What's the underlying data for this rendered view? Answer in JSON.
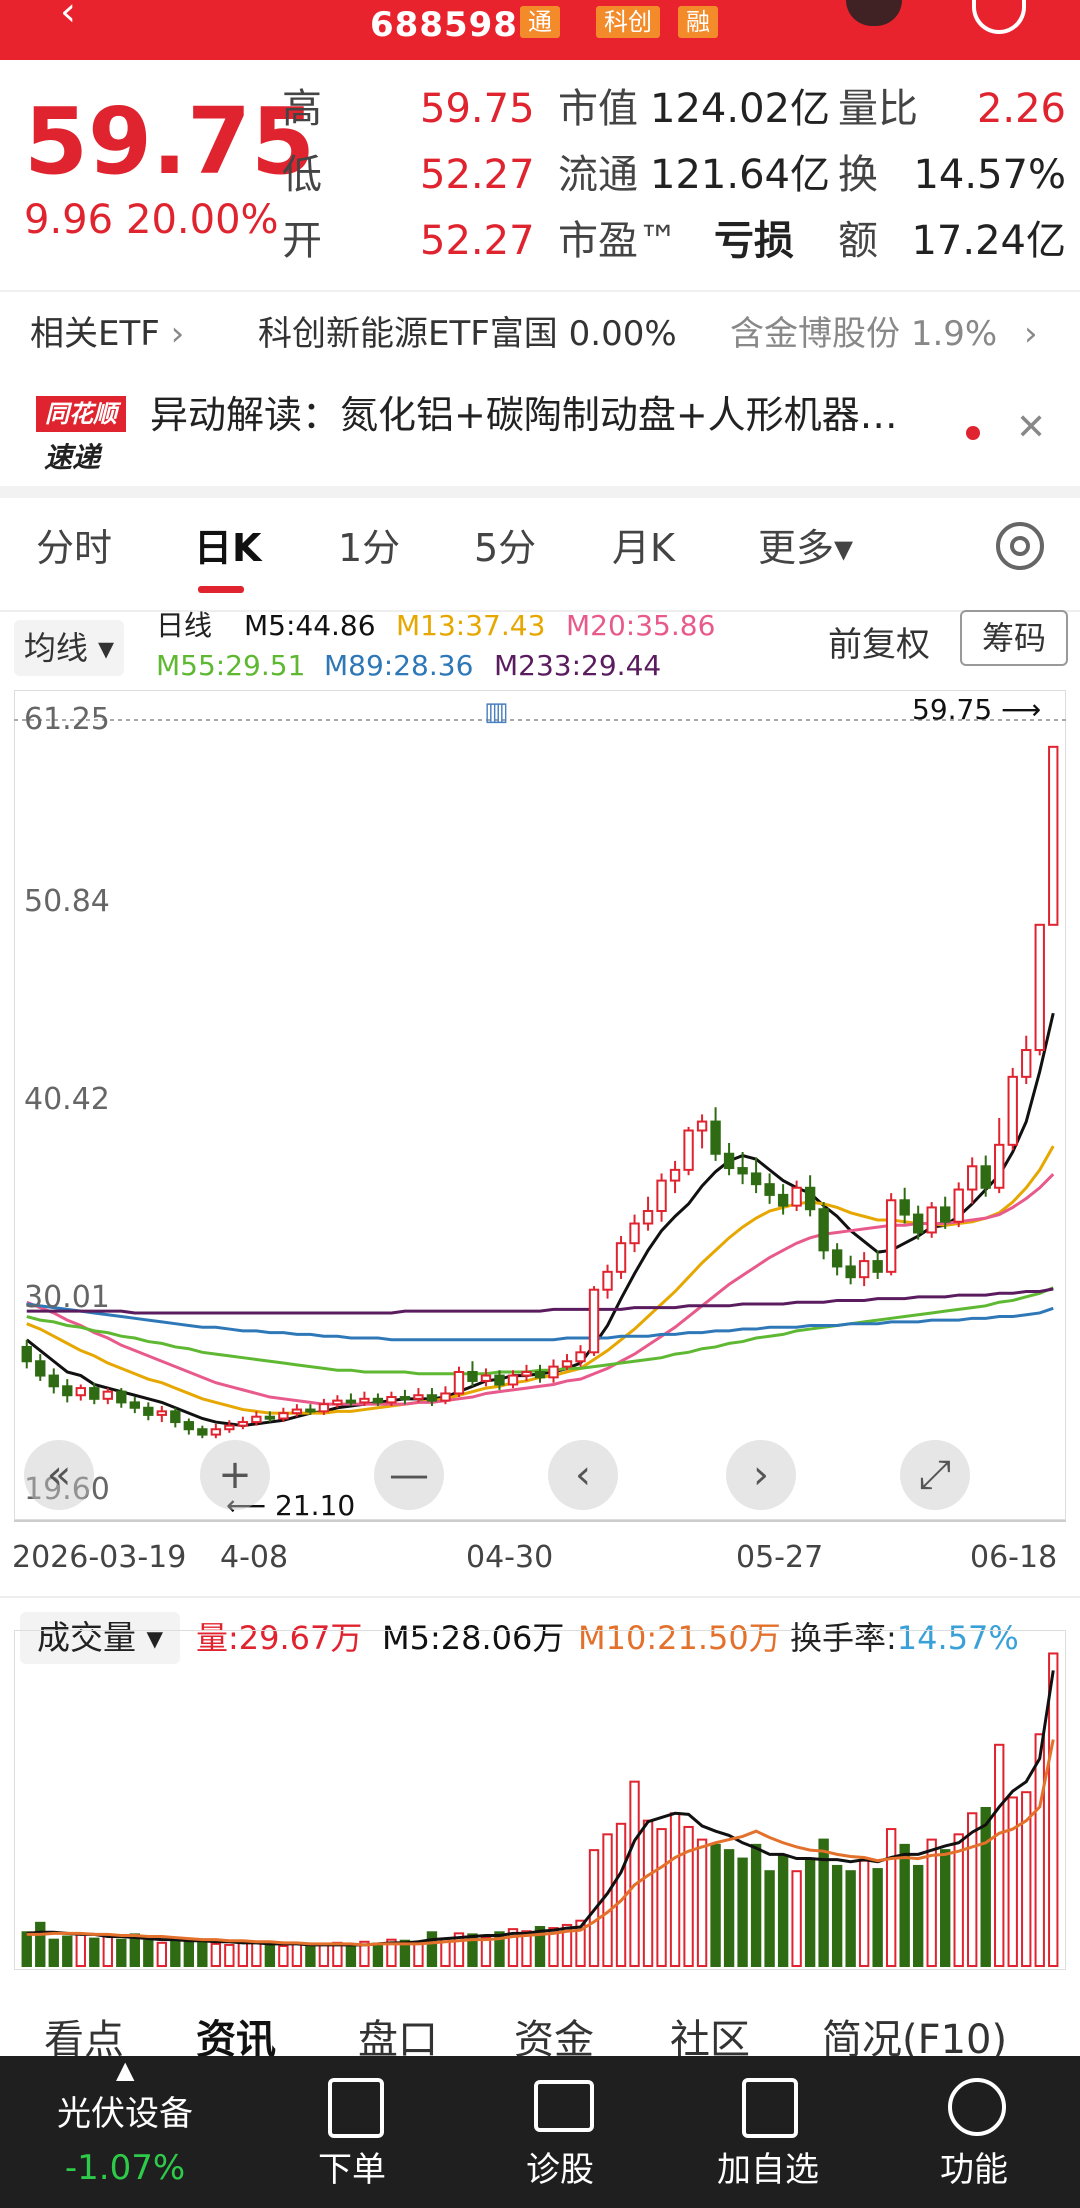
{
  "header": {
    "code": "688598",
    "tags": [
      "通",
      "科创",
      "融"
    ],
    "colors": {
      "bar": "#e8232e",
      "tag": "#f48b2a"
    }
  },
  "quote": {
    "price": "59.75",
    "change": "9.96",
    "change_pct": "20.00%",
    "rows": [
      {
        "l1": "高",
        "v1": "59.75",
        "l2": "市值",
        "v2": "124.02亿",
        "l3": "量比",
        "v3": "2.26"
      },
      {
        "l1": "低",
        "v1": "52.27",
        "l2": "流通",
        "v2": "121.64亿",
        "l3": "换",
        "v3": "14.57%"
      },
      {
        "l1": "开",
        "v1": "52.27",
        "l2": "市盈™",
        "v2": "亏损",
        "l3": "额",
        "v3": "17.24亿"
      }
    ]
  },
  "etf": {
    "label": "相关ETF",
    "item1_name": "科创新能源ETF富国",
    "item1_value": "0.00%",
    "item2_name": "含金博股份",
    "item2_value": "1.9%"
  },
  "news": {
    "logo_top": "同花顺",
    "logo_bottom": "速递",
    "text": "异动解读：氮化铝+碳陶制动盘+人形机器…"
  },
  "tabs": [
    "分时",
    "日K",
    "1分",
    "5分",
    "月K",
    "更多▾"
  ],
  "ma_legend": {
    "button": "均线 ▾",
    "period": "日线",
    "m5": "M5:44.86",
    "m13": "M13:37.43",
    "m20": "M20:35.86",
    "m55": "M55:29.51",
    "m89": "M89:28.36",
    "m233": "M233:29.44",
    "fuquan": "前复权",
    "chip": "筹码",
    "colors": {
      "m5": "#111111",
      "m13": "#e6a700",
      "m20": "#e85a8c",
      "m55": "#5fb832",
      "m89": "#2f78b8",
      "m233": "#5a1c5e"
    }
  },
  "chart": {
    "y_ticks": [
      "61.25",
      "50.84",
      "40.42",
      "30.01",
      "19.60"
    ],
    "x_ticks": [
      "2026-03-19",
      "4-08",
      "04-30",
      "05-27",
      "06-18"
    ],
    "high_label": "59.75",
    "low_label": "21.10",
    "nav": {
      "first": "«",
      "zoom_in": "+",
      "zoom_out": "—",
      "prev": "‹",
      "next": "›",
      "fullscreen": "⤢"
    }
  },
  "chart_data": {
    "type": "candlestick",
    "ylim": [
      19.6,
      61.25
    ],
    "up_color": "#e0242f",
    "down_color": "#2e6b12",
    "candles": [
      [
        26.2,
        25.4,
        26.6,
        25.0
      ],
      [
        25.4,
        24.6,
        25.8,
        24.3
      ],
      [
        24.6,
        24.0,
        25.0,
        23.6
      ],
      [
        24.0,
        23.5,
        24.4,
        23.1
      ],
      [
        23.5,
        23.9,
        24.1,
        23.2
      ],
      [
        23.9,
        23.3,
        24.2,
        23.0
      ],
      [
        23.3,
        23.7,
        23.9,
        23.0
      ],
      [
        23.7,
        23.1,
        23.9,
        22.8
      ],
      [
        23.1,
        22.8,
        23.4,
        22.5
      ],
      [
        22.8,
        22.4,
        23.1,
        22.1
      ],
      [
        22.4,
        22.6,
        22.9,
        22.0
      ],
      [
        22.6,
        22.0,
        22.8,
        21.7
      ],
      [
        22.0,
        21.6,
        22.2,
        21.3
      ],
      [
        21.6,
        21.3,
        21.8,
        21.1
      ],
      [
        21.3,
        21.6,
        21.9,
        21.1
      ],
      [
        21.6,
        21.8,
        22.1,
        21.4
      ],
      [
        21.8,
        22.0,
        22.3,
        21.6
      ],
      [
        22.0,
        22.3,
        22.6,
        21.8
      ],
      [
        22.3,
        22.2,
        22.6,
        22.0
      ],
      [
        22.2,
        22.5,
        22.8,
        22.0
      ],
      [
        22.5,
        22.7,
        23.0,
        22.3
      ],
      [
        22.7,
        22.6,
        23.0,
        22.4
      ],
      [
        22.6,
        23.0,
        23.3,
        22.4
      ],
      [
        23.0,
        23.2,
        23.5,
        22.8
      ],
      [
        23.2,
        23.1,
        23.6,
        22.9
      ],
      [
        23.1,
        23.3,
        23.7,
        22.9
      ],
      [
        23.3,
        23.1,
        23.6,
        22.9
      ],
      [
        23.1,
        23.4,
        23.7,
        22.9
      ],
      [
        23.4,
        23.3,
        23.8,
        23.0
      ],
      [
        23.3,
        23.5,
        23.9,
        23.1
      ],
      [
        23.5,
        23.2,
        23.9,
        22.9
      ],
      [
        23.2,
        23.6,
        24.0,
        23.0
      ],
      [
        23.6,
        24.8,
        25.1,
        23.4
      ],
      [
        24.8,
        24.3,
        25.4,
        24.0
      ],
      [
        24.3,
        24.6,
        25.0,
        24.0
      ],
      [
        24.6,
        24.1,
        24.9,
        23.8
      ],
      [
        24.1,
        24.6,
        24.9,
        23.9
      ],
      [
        24.6,
        24.8,
        25.2,
        24.3
      ],
      [
        24.8,
        24.5,
        25.2,
        24.2
      ],
      [
        24.5,
        25.1,
        25.5,
        24.2
      ],
      [
        25.1,
        25.4,
        25.8,
        24.9
      ],
      [
        25.4,
        25.9,
        26.3,
        25.1
      ],
      [
        25.9,
        29.4,
        29.6,
        25.7
      ],
      [
        29.4,
        30.4,
        30.8,
        28.9
      ],
      [
        30.4,
        32.0,
        32.4,
        30.0
      ],
      [
        32.0,
        33.1,
        33.6,
        31.5
      ],
      [
        33.1,
        33.8,
        34.6,
        32.7
      ],
      [
        33.8,
        35.5,
        35.9,
        33.2
      ],
      [
        35.5,
        36.1,
        36.6,
        34.8
      ],
      [
        36.1,
        38.3,
        38.5,
        35.8
      ],
      [
        38.3,
        38.8,
        39.2,
        37.3
      ],
      [
        38.8,
        37.0,
        39.6,
        36.6
      ],
      [
        37.0,
        36.2,
        37.6,
        35.8
      ],
      [
        36.2,
        35.9,
        37.1,
        35.3
      ],
      [
        35.9,
        35.3,
        36.8,
        34.8
      ],
      [
        35.3,
        34.7,
        35.9,
        34.2
      ],
      [
        34.7,
        34.1,
        35.3,
        33.6
      ],
      [
        34.1,
        35.1,
        35.5,
        33.8
      ],
      [
        35.1,
        33.9,
        35.8,
        33.5
      ],
      [
        33.9,
        31.6,
        34.3,
        31.1
      ],
      [
        31.6,
        30.7,
        32.0,
        30.2
      ],
      [
        30.7,
        30.1,
        31.3,
        29.7
      ],
      [
        30.1,
        31.0,
        31.5,
        29.6
      ],
      [
        31.0,
        30.4,
        31.6,
        30.0
      ],
      [
        30.4,
        34.4,
        34.8,
        30.2
      ],
      [
        34.4,
        33.6,
        35.1,
        33.1
      ],
      [
        33.6,
        32.6,
        34.1,
        32.2
      ],
      [
        32.6,
        34.0,
        34.3,
        32.3
      ],
      [
        34.0,
        33.2,
        34.6,
        32.8
      ],
      [
        33.2,
        35.0,
        35.4,
        32.9
      ],
      [
        35.0,
        36.3,
        36.8,
        34.2
      ],
      [
        36.3,
        35.1,
        36.9,
        34.6
      ],
      [
        35.1,
        37.5,
        39.0,
        34.8
      ],
      [
        37.5,
        41.3,
        41.8,
        37.2
      ],
      [
        41.3,
        42.8,
        43.6,
        40.9
      ],
      [
        42.8,
        49.8,
        49.8,
        42.5
      ],
      [
        49.8,
        59.75,
        59.75,
        52.27
      ]
    ],
    "ma": {
      "m5": [
        26.6,
        26.0,
        25.4,
        24.8,
        24.6,
        24.1,
        23.9,
        23.7,
        23.5,
        23.3,
        23.1,
        22.8,
        22.5,
        22.2,
        22.0,
        21.9,
        21.8,
        21.9,
        22.0,
        22.1,
        22.3,
        22.5,
        22.6,
        22.8,
        22.9,
        23.0,
        23.1,
        23.2,
        23.3,
        23.3,
        23.3,
        23.4,
        23.7,
        24.0,
        24.3,
        24.4,
        24.6,
        24.6,
        24.7,
        24.8,
        25.0,
        25.3,
        26.3,
        27.4,
        28.9,
        30.3,
        31.6,
        32.7,
        33.5,
        34.2,
        35.2,
        36.0,
        36.6,
        36.9,
        36.7,
        36.1,
        35.5,
        35.1,
        34.8,
        34.1,
        33.5,
        32.7,
        32.1,
        31.5,
        31.6,
        32.0,
        32.4,
        32.9,
        33.0,
        33.5,
        34.2,
        35.0,
        35.8,
        37.1,
        38.8,
        41.6,
        44.86
      ],
      "m13": [
        27.5,
        27.2,
        26.8,
        26.4,
        26.0,
        25.7,
        25.3,
        25.0,
        24.7,
        24.4,
        24.2,
        23.9,
        23.6,
        23.3,
        23.1,
        22.9,
        22.7,
        22.6,
        22.5,
        22.5,
        22.5,
        22.5,
        22.5,
        22.6,
        22.6,
        22.7,
        22.8,
        22.9,
        23.0,
        23.1,
        23.2,
        23.3,
        23.5,
        23.7,
        23.9,
        24.0,
        24.2,
        24.3,
        24.5,
        24.6,
        24.8,
        25.0,
        25.5,
        26.0,
        26.6,
        27.2,
        27.9,
        28.6,
        29.3,
        30.1,
        30.9,
        31.6,
        32.3,
        32.9,
        33.4,
        33.8,
        34.0,
        34.2,
        34.3,
        34.2,
        34.0,
        33.7,
        33.5,
        33.3,
        33.3,
        33.2,
        33.1,
        33.1,
        33.0,
        33.1,
        33.2,
        33.4,
        33.7,
        34.3,
        35.1,
        36.1,
        37.43
      ],
      "m20": [
        28.7,
        28.4,
        28.1,
        27.7,
        27.4,
        27.0,
        26.7,
        26.3,
        26.0,
        25.7,
        25.4,
        25.1,
        24.8,
        24.5,
        24.2,
        24.0,
        23.8,
        23.6,
        23.4,
        23.3,
        23.2,
        23.1,
        23.0,
        23.0,
        23.0,
        23.0,
        23.0,
        23.0,
        23.0,
        23.1,
        23.1,
        23.2,
        23.3,
        23.4,
        23.6,
        23.7,
        23.8,
        23.9,
        24.0,
        24.1,
        24.3,
        24.4,
        24.7,
        25.0,
        25.4,
        25.8,
        26.3,
        26.8,
        27.3,
        27.9,
        28.5,
        29.1,
        29.7,
        30.2,
        30.7,
        31.2,
        31.6,
        32.0,
        32.3,
        32.5,
        32.6,
        32.7,
        32.8,
        32.9,
        33.0,
        33.0,
        33.1,
        33.1,
        33.1,
        33.2,
        33.3,
        33.4,
        33.6,
        34.0,
        34.5,
        35.1,
        35.86
      ],
      "m55": [
        27.9,
        27.7,
        27.6,
        27.4,
        27.3,
        27.1,
        27.0,
        26.8,
        26.7,
        26.5,
        26.4,
        26.2,
        26.1,
        25.9,
        25.8,
        25.7,
        25.6,
        25.5,
        25.4,
        25.3,
        25.2,
        25.1,
        25.0,
        24.9,
        24.9,
        24.8,
        24.8,
        24.8,
        24.8,
        24.7,
        24.7,
        24.7,
        24.7,
        24.7,
        24.7,
        24.8,
        24.8,
        24.8,
        24.9,
        24.9,
        25.0,
        25.0,
        25.1,
        25.2,
        25.3,
        25.4,
        25.5,
        25.6,
        25.8,
        25.9,
        26.1,
        26.2,
        26.4,
        26.5,
        26.7,
        26.8,
        26.9,
        27.1,
        27.2,
        27.3,
        27.4,
        27.5,
        27.6,
        27.7,
        27.8,
        27.9,
        28.0,
        28.1,
        28.2,
        28.3,
        28.4,
        28.5,
        28.7,
        28.8,
        29.0,
        29.2,
        29.51
      ],
      "m89": [
        28.6,
        28.5,
        28.4,
        28.3,
        28.2,
        28.1,
        28.0,
        27.9,
        27.8,
        27.7,
        27.6,
        27.5,
        27.4,
        27.3,
        27.3,
        27.2,
        27.1,
        27.1,
        27.0,
        27.0,
        26.9,
        26.9,
        26.8,
        26.8,
        26.7,
        26.7,
        26.7,
        26.6,
        26.6,
        26.6,
        26.6,
        26.6,
        26.6,
        26.6,
        26.6,
        26.6,
        26.6,
        26.6,
        26.6,
        26.6,
        26.7,
        26.7,
        26.7,
        26.7,
        26.8,
        26.8,
        26.8,
        26.9,
        26.9,
        27.0,
        27.0,
        27.1,
        27.1,
        27.2,
        27.2,
        27.3,
        27.3,
        27.3,
        27.4,
        27.4,
        27.4,
        27.5,
        27.5,
        27.5,
        27.6,
        27.6,
        27.6,
        27.7,
        27.7,
        27.7,
        27.8,
        27.8,
        27.9,
        27.9,
        28.0,
        28.1,
        28.36
      ],
      "m233": [
        28.2,
        28.2,
        28.2,
        28.2,
        28.2,
        28.2,
        28.2,
        28.2,
        28.1,
        28.1,
        28.1,
        28.1,
        28.1,
        28.1,
        28.1,
        28.1,
        28.1,
        28.1,
        28.1,
        28.1,
        28.1,
        28.1,
        28.1,
        28.1,
        28.1,
        28.1,
        28.1,
        28.1,
        28.2,
        28.2,
        28.2,
        28.2,
        28.2,
        28.2,
        28.2,
        28.2,
        28.2,
        28.2,
        28.2,
        28.3,
        28.3,
        28.3,
        28.3,
        28.3,
        28.3,
        28.4,
        28.4,
        28.4,
        28.4,
        28.5,
        28.5,
        28.5,
        28.5,
        28.6,
        28.6,
        28.6,
        28.6,
        28.7,
        28.7,
        28.7,
        28.8,
        28.8,
        28.8,
        28.9,
        28.9,
        28.9,
        29.0,
        29.0,
        29.0,
        29.1,
        29.1,
        29.1,
        29.2,
        29.2,
        29.3,
        29.3,
        29.44
      ]
    },
    "volume": {
      "label": "成交量 ▾",
      "vol": "量:29.67万",
      "m5": "M5:28.06万",
      "m10": "M10:21.50万",
      "turnover_label": "换手率:",
      "turnover": "14.57%",
      "ylim": [
        0,
        30
      ],
      "values": [
        3.2,
        4.1,
        2.5,
        2.8,
        3.0,
        2.6,
        2.9,
        2.5,
        3.0,
        2.4,
        2.2,
        2.6,
        2.3,
        2.5,
        2.1,
        2.0,
        2.4,
        2.2,
        2.0,
        1.9,
        2.1,
        1.8,
        2.0,
        2.2,
        1.9,
        2.3,
        2.1,
        2.5,
        2.4,
        2.2,
        3.2,
        2.6,
        3.1,
        3.0,
        2.7,
        3.2,
        3.5,
        3.3,
        3.7,
        3.6,
        3.9,
        4.3,
        11.0,
        12.5,
        13.5,
        17.5,
        13.8,
        13.0,
        14.5,
        13.2,
        12.0,
        11.5,
        11.0,
        10.2,
        11.5,
        9.0,
        10.5,
        9.0,
        10.0,
        12.0,
        9.5,
        9.0,
        10.0,
        9.2,
        13.0,
        11.5,
        9.5,
        12.0,
        11.0,
        12.5,
        14.5,
        15.0,
        21.0,
        16.0,
        16.5,
        22.0,
        29.67
      ],
      "ma5": [
        3.1,
        3.2,
        3.2,
        3.1,
        3.0,
        3.0,
        2.8,
        2.8,
        2.7,
        2.6,
        2.5,
        2.5,
        2.4,
        2.4,
        2.3,
        2.3,
        2.2,
        2.2,
        2.1,
        2.1,
        2.1,
        2.0,
        2.0,
        2.0,
        2.0,
        2.0,
        2.1,
        2.2,
        2.2,
        2.3,
        2.5,
        2.6,
        2.7,
        2.8,
        2.9,
        2.9,
        3.1,
        3.1,
        3.3,
        3.4,
        3.6,
        3.7,
        5.3,
        6.9,
        8.9,
        11.9,
        13.7,
        14.1,
        14.5,
        14.4,
        13.3,
        12.8,
        12.4,
        11.7,
        11.2,
        10.6,
        10.6,
        10.2,
        10.2,
        10.1,
        10.1,
        9.9,
        10.1,
        9.9,
        10.3,
        10.6,
        10.6,
        11.0,
        11.4,
        11.7,
        12.7,
        13.4,
        15.1,
        16.6,
        17.5,
        19.7,
        28.06
      ],
      "ma10": [
        3.0,
        3.0,
        3.1,
        3.1,
        3.1,
        3.0,
        3.0,
        2.9,
        2.9,
        2.8,
        2.8,
        2.7,
        2.6,
        2.5,
        2.5,
        2.4,
        2.4,
        2.3,
        2.3,
        2.2,
        2.2,
        2.1,
        2.1,
        2.1,
        2.1,
        2.0,
        2.1,
        2.1,
        2.1,
        2.1,
        2.2,
        2.3,
        2.4,
        2.5,
        2.5,
        2.6,
        2.8,
        2.9,
        3.0,
        3.1,
        3.3,
        3.4,
        4.2,
        5.1,
        6.2,
        7.7,
        8.6,
        9.4,
        10.3,
        10.9,
        11.3,
        11.7,
        12.0,
        12.3,
        12.8,
        12.2,
        11.7,
        11.3,
        11.0,
        10.9,
        10.6,
        10.4,
        10.3,
        10.0,
        10.2,
        10.3,
        10.2,
        10.5,
        10.6,
        10.9,
        11.3,
        11.7,
        12.6,
        13.0,
        13.8,
        15.1,
        21.5
      ]
    }
  },
  "subtabs": [
    "看点",
    "资讯",
    "盘口",
    "资金",
    "社区",
    "简况(F10)"
  ],
  "bottom": {
    "sector_name": "光伏设备",
    "sector_chg": "-1.07%",
    "items": [
      "下单",
      "诊股",
      "加自选",
      "功能"
    ]
  }
}
